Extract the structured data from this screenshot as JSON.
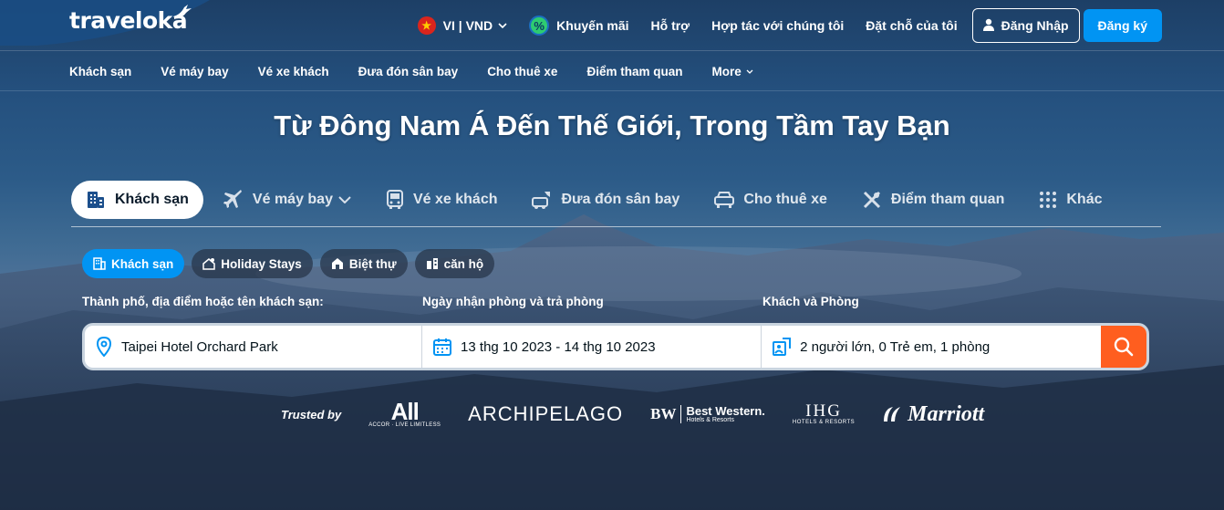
{
  "logo": {
    "text": "traveloka"
  },
  "topnav": {
    "locale": "VI | VND",
    "promo": "Khuyến mãi",
    "support": "Hỗ trợ",
    "partner": "Hợp tác với chúng tôi",
    "bookings": "Đặt chỗ của tôi",
    "login": "Đăng Nhập",
    "register": "Đăng ký"
  },
  "prodnav": [
    "Khách sạn",
    "Vé máy bay",
    "Vé xe khách",
    "Đưa đón sân bay",
    "Cho thuê xe",
    "Điểm tham quan",
    "More"
  ],
  "hero": {
    "title": "Từ Đông Nam Á Đến Thế Giới, Trong Tầm Tay Bạn"
  },
  "tabs": [
    "Khách sạn",
    "Vé máy bay",
    "Vé xe khách",
    "Đưa đón sân bay",
    "Cho thuê xe",
    "Điểm tham quan",
    "Khác"
  ],
  "chips": [
    "Khách sạn",
    "Holiday Stays",
    "Biệt thự",
    "căn hộ"
  ],
  "search": {
    "label_destination": "Thành phố, địa điểm hoặc tên khách sạn:",
    "label_dates": "Ngày nhận phòng và trả phòng",
    "label_guests": "Khách và Phòng",
    "destination": "Taipei Hotel Orchard Park",
    "dates": "13 thg 10 2023 - 14 thg 10 2023",
    "guests": "2 người lớn, 0 Trẻ em, 1 phòng"
  },
  "trusted": {
    "label": "Trusted by",
    "brands": {
      "accor_main": "All",
      "accor_sub": "ACCOR · LIVE LIMITLESS",
      "archipelago": "ARCHIPELAGO",
      "bw_mark": "BW",
      "bw_name": "Best Western.",
      "bw_sub": "Hotels & Resorts",
      "ihg_main": "IHG",
      "ihg_sub": "HOTELS & RESORTS",
      "marriott": "Marriott"
    }
  },
  "colors": {
    "brand_blue": "#0194f3",
    "search_orange": "#ff5e1f"
  }
}
